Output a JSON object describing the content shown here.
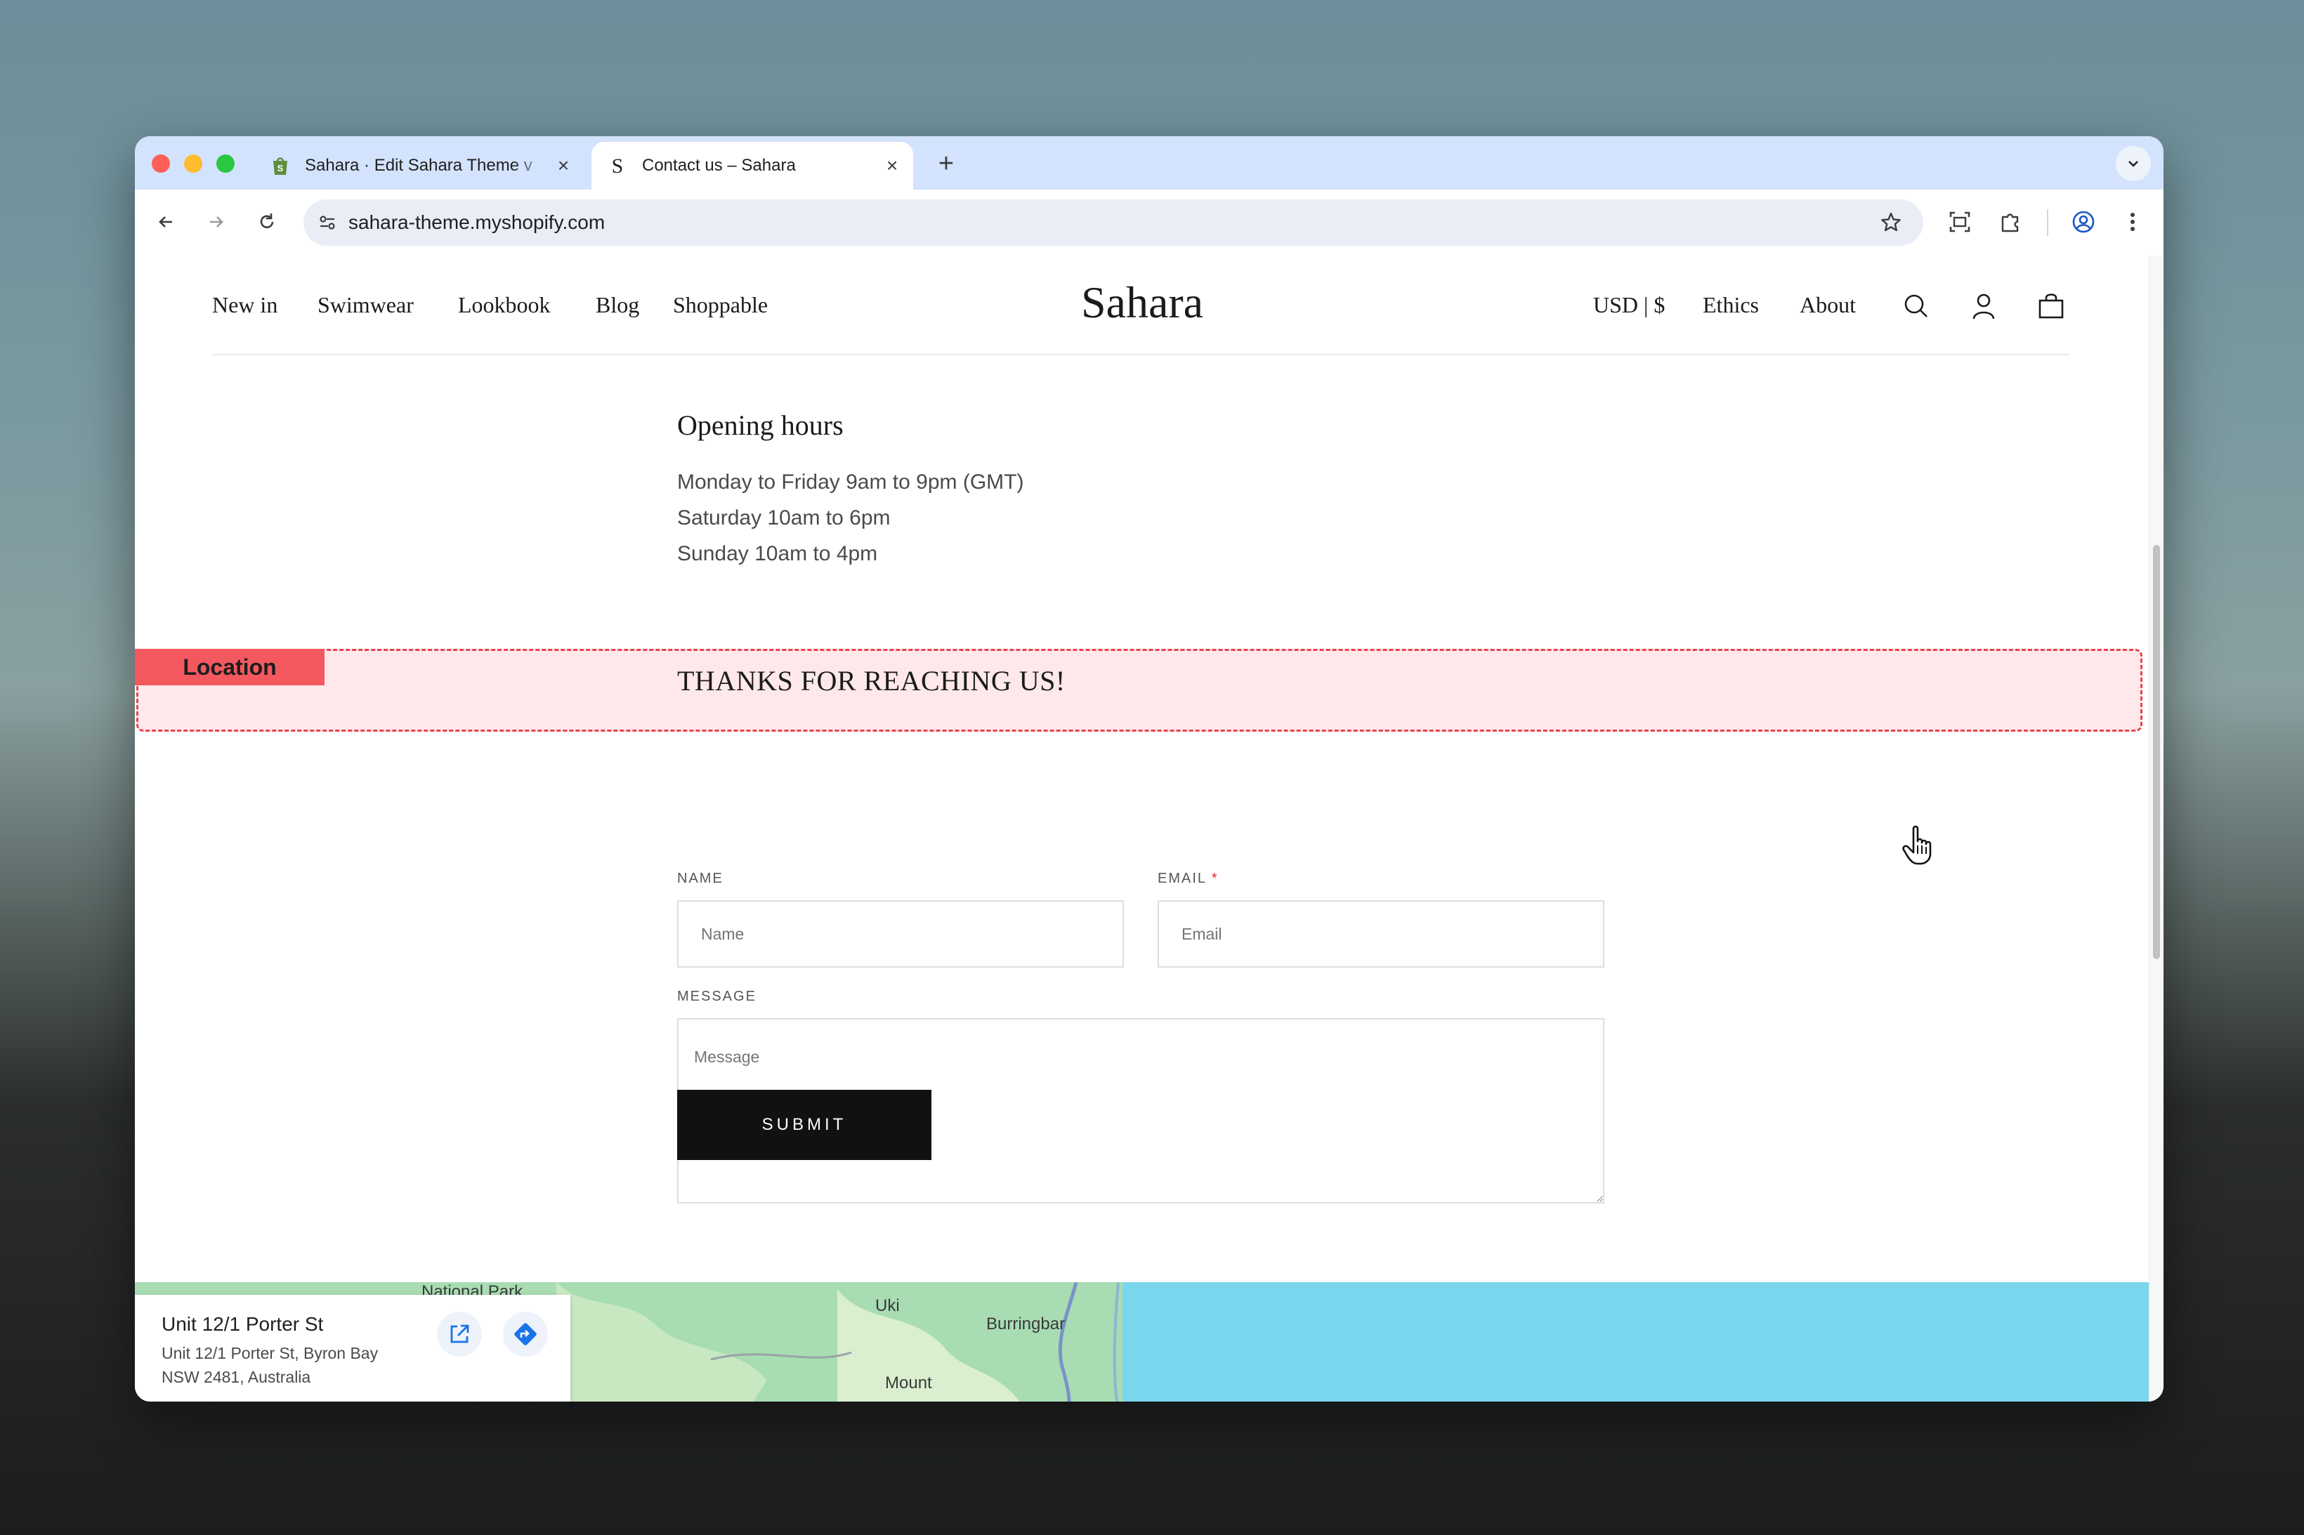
{
  "browser": {
    "tabs": [
      {
        "title": "Sahara · Edit Sahara Theme v",
        "favicon": "shopify-bag-icon",
        "active": false
      },
      {
        "title": "Contact us – Sahara",
        "favicon": "sahara-s-icon",
        "active": true
      }
    ],
    "new_tab_label": "+",
    "close_label": "×",
    "url": "sahara-theme.myshopify.com"
  },
  "site": {
    "logo": "Sahara",
    "nav_left": [
      "New in",
      "Swimwear",
      "Lookbook",
      "Blog",
      "Shoppable"
    ],
    "nav_right": [
      "USD | $",
      "Ethics",
      "About"
    ]
  },
  "hours": {
    "title": "Opening hours",
    "lines": [
      "Monday to Friday 9am to 9pm (GMT)",
      "Saturday 10am to 6pm",
      "Sunday 10am to 4pm"
    ]
  },
  "section_tag": "Location",
  "form": {
    "heading": "THANKS FOR REACHING US!",
    "name_label": "NAME",
    "name_placeholder": "Name",
    "email_label": "EMAIL",
    "email_required": "*",
    "email_placeholder": "Email",
    "message_label": "MESSAGE",
    "message_placeholder": "Message",
    "submit_label": "SUBMIT"
  },
  "map": {
    "place_title": "Unit 12/1 Porter St",
    "address_line1": "Unit 12/1 Porter St, Byron Bay",
    "address_line2": "NSW 2481, Australia",
    "labels": [
      "National Park",
      "Uki",
      "Burringbar",
      "Mount"
    ]
  },
  "colors": {
    "tabstrip": "#d3e3fd",
    "highlight_border": "#e8434f",
    "highlight_tag": "#f4585f",
    "submit_bg": "#111111",
    "map_land": "#a8dcb3",
    "map_sea": "#7ad6ec"
  }
}
